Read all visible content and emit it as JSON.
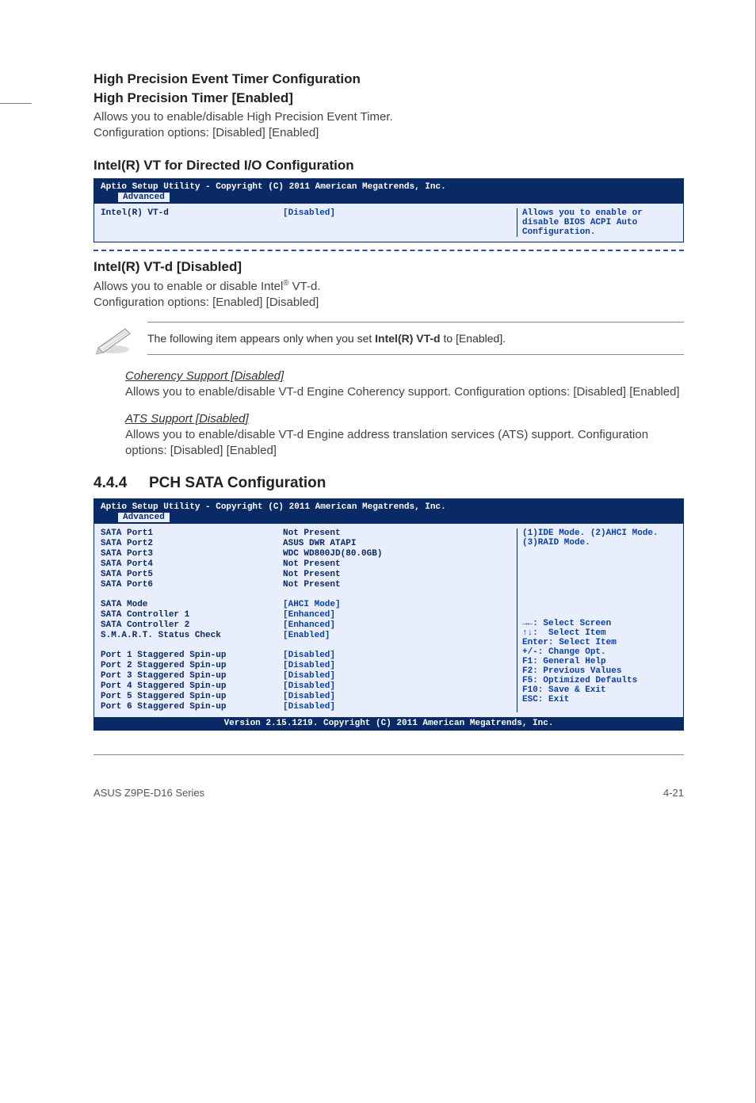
{
  "hpet": {
    "config_title": "High Precision Event Timer Configuration",
    "timer_title": "High Precision Timer [Enabled]",
    "desc1": "Allows you to enable/disable High Precision Event Timer.",
    "desc2": "Configuration options: [Disabled] [Enabled]"
  },
  "vtio": {
    "title": "Intel(R) VT for Directed I/O Configuration"
  },
  "bios1": {
    "header": "Aptio Setup Utility - Copyright (C) 2011 American Megatrends, Inc.",
    "tab": "Advanced",
    "row_label": "Intel(R) VT-d",
    "row_value": "[Disabled]",
    "help": "Allows you to enable or disable BIOS ACPI Auto Configuration."
  },
  "vtd": {
    "title": "Intel(R) VT-d [Disabled]",
    "desc_pre": "Allows you to enable or disable Intel",
    "desc_post": " VT-d.",
    "reg": "®",
    "cfg": "Configuration options: [Enabled] [Disabled]"
  },
  "note": {
    "pre": "The following item appears only when you set ",
    "bold": "Intel(R) VT-d",
    "post": " to [Enabled]."
  },
  "coherency": {
    "title": "Coherency Support [Disabled]",
    "desc": "Allows you to enable/disable VT-d Engine Coherency support. Configuration options: [Disabled] [Enabled]"
  },
  "ats": {
    "title": "ATS Support [Disabled]",
    "desc": "Allows you to enable/disable VT-d Engine address translation services (ATS) support. Configuration options: [Disabled] [Enabled]"
  },
  "pch": {
    "num": "4.4.4",
    "title": "PCH SATA Configuration"
  },
  "bios2": {
    "header": "Aptio Setup Utility - Copyright (C) 2011 American Megatrends, Inc.",
    "tab": "Advanced",
    "ports": [
      {
        "label": "SATA Port1",
        "value": "Not Present"
      },
      {
        "label": "SATA Port2",
        "value": "ASUS DWR ATAPI"
      },
      {
        "label": "SATA Port3",
        "value": "WDC WD800JD(80.0GB)"
      },
      {
        "label": "SATA Port4",
        "value": "Not Present"
      },
      {
        "label": "SATA Port5",
        "value": "Not Present"
      },
      {
        "label": "SATA Port6",
        "value": "Not Present"
      }
    ],
    "settings": [
      {
        "label": "SATA Mode",
        "value": "[AHCI Mode]"
      },
      {
        "label": "SATA Controller 1",
        "value": "[Enhanced]"
      },
      {
        "label": "SATA Controller 2",
        "value": "[Enhanced]"
      },
      {
        "label": "S.M.A.R.T. Status Check",
        "value": "[Enabled]"
      }
    ],
    "spinup": [
      {
        "label": "Port 1 Staggered Spin-up",
        "value": "[Disabled]"
      },
      {
        "label": "Port 2 Staggered Spin-up",
        "value": "[Disabled]"
      },
      {
        "label": "Port 3 Staggered Spin-up",
        "value": "[Disabled]"
      },
      {
        "label": "Port 4 Staggered Spin-up",
        "value": "[Disabled]"
      },
      {
        "label": "Port 5 Staggered Spin-up",
        "value": "[Disabled]"
      },
      {
        "label": "Port 6 Staggered Spin-up",
        "value": "[Disabled]"
      }
    ],
    "help_top": "(1)IDE Mode. (2)AHCI Mode. (3)RAID Mode.",
    "help_keys": [
      "→←: Select Screen",
      "↑↓:  Select Item",
      "Enter: Select Item",
      "+/-: Change Opt.",
      "F1: General Help",
      "F2: Previous Values",
      "F5: Optimized Defaults",
      "F10: Save & Exit",
      "ESC: Exit"
    ],
    "footer": "Version 2.15.1219. Copyright (C) 2011 American Megatrends, Inc."
  },
  "footer": {
    "left": "ASUS Z9PE-D16 Series",
    "right": "4-21"
  }
}
